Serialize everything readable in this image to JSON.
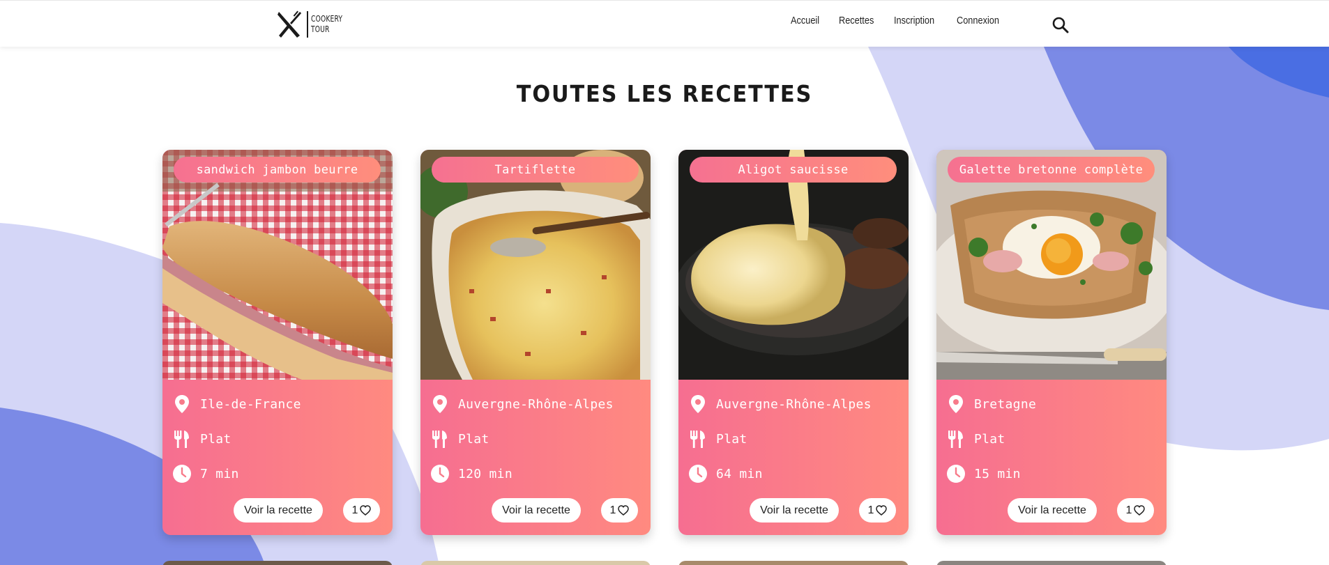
{
  "header": {
    "logo_line1": "COOKERY",
    "logo_line2": "TOUR",
    "nav": [
      {
        "label": "Accueil"
      },
      {
        "label": "Recettes"
      },
      {
        "label": "Inscription"
      },
      {
        "label": "Connexion"
      }
    ],
    "search_icon": "search-icon"
  },
  "page": {
    "title": "TOUTES LES RECETTES"
  },
  "recipes": [
    {
      "title": "sandwich jambon beurre",
      "region": "Ile-de-France",
      "type": "Plat",
      "time": "7 min",
      "view_label": "Voir la recette",
      "likes": "1"
    },
    {
      "title": "Tartiflette",
      "region": "Auvergne-Rhône-Alpes",
      "type": "Plat",
      "time": "120 min",
      "view_label": "Voir la recette",
      "likes": "1"
    },
    {
      "title": "Aligot saucisse",
      "region": "Auvergne-Rhône-Alpes",
      "type": "Plat",
      "time": "64 min",
      "view_label": "Voir la recette",
      "likes": "1"
    },
    {
      "title": "Galette bretonne complète",
      "region": "Bretagne",
      "type": "Plat",
      "time": "15 min",
      "view_label": "Voir la recette",
      "likes": "1"
    }
  ],
  "colors": {
    "card_gradient_start": "#f66e91",
    "card_gradient_end": "#ff8a80",
    "blob_light": "#d4d6f7",
    "blob_mid": "#7b8ae6",
    "blob_dark": "#4a6ee3"
  }
}
